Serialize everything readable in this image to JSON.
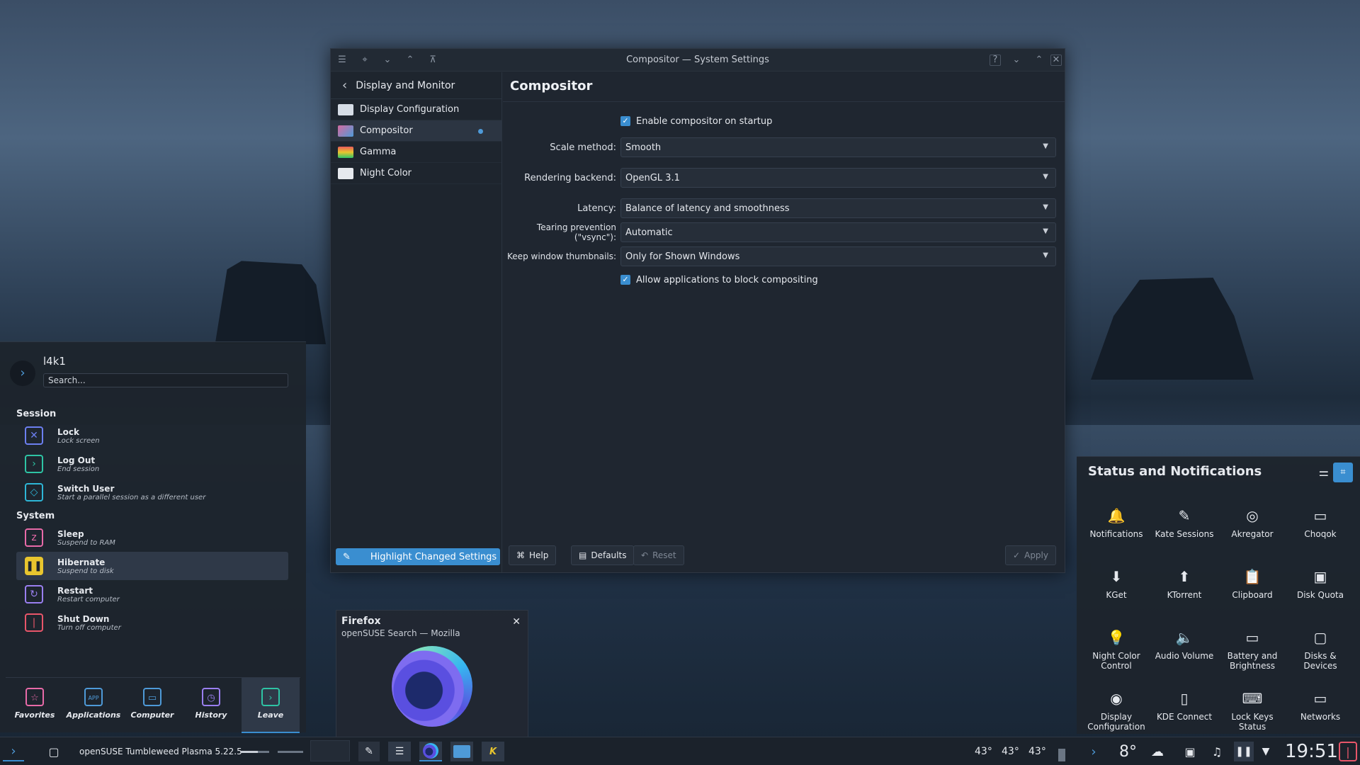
{
  "window": {
    "title": "Compositor — System Settings",
    "sidebar_title": "Display and Monitor",
    "sidebar_items": [
      {
        "label": "Display Configuration",
        "color": "#d6dde6"
      },
      {
        "label": "Compositor",
        "color": "#d46ba0"
      },
      {
        "label": "Gamma",
        "color": "#e85a5a"
      },
      {
        "label": "Night Color",
        "color": "#e6e9ee"
      }
    ],
    "highlight_button": "Highlight Changed Settings",
    "page_title": "Compositor",
    "enable_startup": "Enable compositor on startup",
    "scale_label": "Scale method:",
    "scale_value": "Smooth",
    "backend_label": "Rendering backend:",
    "backend_value": "OpenGL 3.1",
    "latency_label": "Latency:",
    "latency_value": "Balance of latency and smoothness",
    "tearing_label": "Tearing prevention (\"vsync\"):",
    "tearing_value": "Automatic",
    "thumbs_label": "Keep window thumbnails:",
    "thumbs_value": "Only for Shown Windows",
    "allow_block": "Allow applications to block compositing",
    "help": "Help",
    "defaults": "Defaults",
    "reset": "Reset",
    "apply": "Apply"
  },
  "menu": {
    "user": "l4k1",
    "search_placeholder": "Search...",
    "session_title": "Session",
    "system_title": "System",
    "items": [
      {
        "title": "Lock",
        "sub": "Lock screen",
        "color": "#6c7ff0"
      },
      {
        "title": "Log Out",
        "sub": "End session",
        "color": "#2ec4a4"
      },
      {
        "title": "Switch User",
        "sub": "Start a parallel session as a different user",
        "color": "#2eb6d6"
      },
      {
        "title": "Sleep",
        "sub": "Suspend to RAM",
        "color": "#e86aa8"
      },
      {
        "title": "Hibernate",
        "sub": "Suspend to disk",
        "color": "#e8c52e"
      },
      {
        "title": "Restart",
        "sub": "Restart computer",
        "color": "#9a7ff0"
      },
      {
        "title": "Shut Down",
        "sub": "Turn off computer",
        "color": "#e8566a"
      }
    ],
    "tabs": [
      {
        "label": "Favorites",
        "color": "#e86aa8"
      },
      {
        "label": "Applications",
        "color": "#4e9ad8"
      },
      {
        "label": "Computer",
        "color": "#4e9ad8"
      },
      {
        "label": "History",
        "color": "#9a7ff0"
      },
      {
        "label": "Leave",
        "color": "#2ec4a4"
      }
    ]
  },
  "firefox_preview": {
    "title": "Firefox",
    "subtitle": "openSUSE Search — Mozilla"
  },
  "status": {
    "title": "Status and Notifications",
    "items": [
      {
        "label": "Notifications",
        "icon": "bell-icon",
        "glyph": "🔔"
      },
      {
        "label": "Kate Sessions",
        "icon": "kate-icon",
        "glyph": "✎"
      },
      {
        "label": "Akregator",
        "icon": "rss-icon",
        "glyph": "◎"
      },
      {
        "label": "Choqok",
        "icon": "chat-icon",
        "glyph": "▭"
      },
      {
        "label": "KGet",
        "icon": "download-icon",
        "glyph": "⬇"
      },
      {
        "label": "KTorrent",
        "icon": "torrent-icon",
        "glyph": "⬆"
      },
      {
        "label": "Clipboard",
        "icon": "clipboard-icon",
        "glyph": "📋"
      },
      {
        "label": "Disk Quota",
        "icon": "disk-quota-icon",
        "glyph": "▣"
      },
      {
        "label": "Night Color Control",
        "icon": "bulb-icon",
        "glyph": "💡"
      },
      {
        "label": "Audio Volume",
        "icon": "speaker-icon",
        "glyph": "🔈"
      },
      {
        "label": "Battery and Brightness",
        "icon": "battery-icon",
        "glyph": "▭"
      },
      {
        "label": "Disks & Devices",
        "icon": "drive-icon",
        "glyph": "▢"
      },
      {
        "label": "Display Configuration",
        "icon": "display-icon",
        "glyph": "◉"
      },
      {
        "label": "KDE Connect",
        "icon": "phone-icon",
        "glyph": "▯"
      },
      {
        "label": "Lock Keys Status",
        "icon": "keyboard-icon",
        "glyph": "⌨"
      },
      {
        "label": "Networks",
        "icon": "network-icon",
        "glyph": "▭"
      }
    ]
  },
  "taskbar": {
    "task_label": "openSUSE Tumbleweed Plasma 5.22.5",
    "temp1": "43°",
    "temp2": "43°",
    "temp3": "43°",
    "weather": "8°",
    "clock": "19:51"
  },
  "colors": {
    "accent": "#3a8ed0"
  }
}
